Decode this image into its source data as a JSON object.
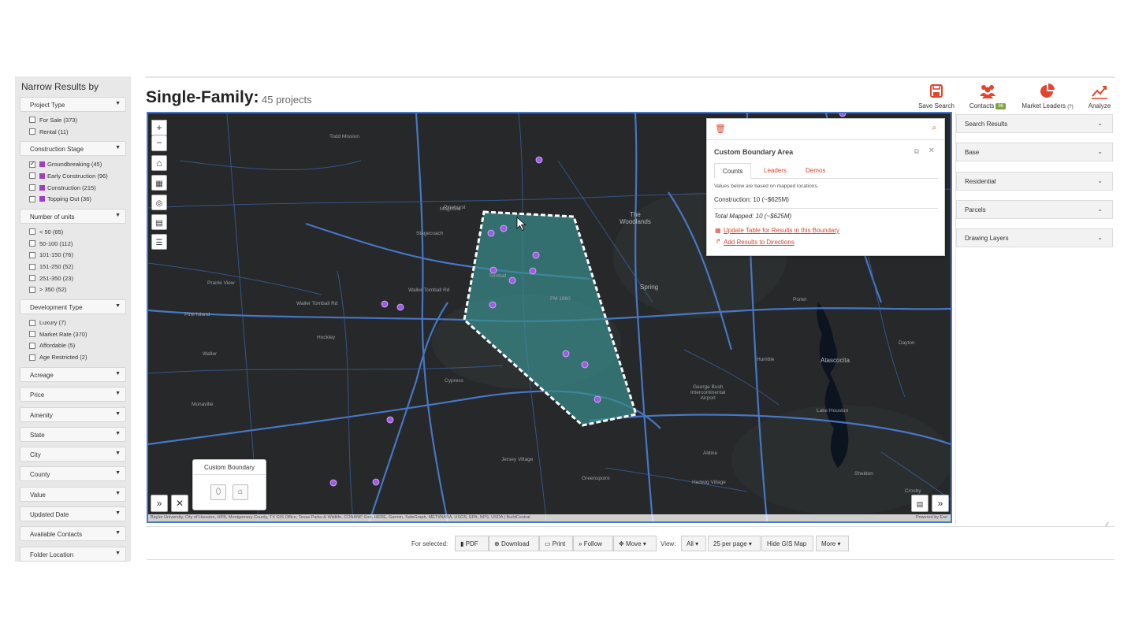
{
  "sidebar": {
    "title": "Narrow Results by",
    "groups": [
      {
        "label": "Project Type",
        "options": [
          {
            "label": "For Sale (373)",
            "checked": false
          },
          {
            "label": "Rental (11)",
            "checked": false
          }
        ]
      },
      {
        "label": "Construction Stage",
        "options": [
          {
            "label": "Groundbreaking (45)",
            "checked": true
          },
          {
            "label": "Early Construction (96)",
            "checked": false
          },
          {
            "label": "Construction (215)",
            "checked": false
          },
          {
            "label": "Topping Out (36)",
            "checked": false
          }
        ]
      },
      {
        "label": "Number of units",
        "options": [
          {
            "label": "< 50 (65)",
            "checked": false
          },
          {
            "label": "50-100 (112)",
            "checked": false
          },
          {
            "label": "101-150 (76)",
            "checked": false
          },
          {
            "label": "151-250 (52)",
            "checked": false
          },
          {
            "label": "251-350 (23)",
            "checked": false
          },
          {
            "label": "> 350 (52)",
            "checked": false
          }
        ]
      },
      {
        "label": "Development Type",
        "options": [
          {
            "label": "Luxury (7)",
            "checked": false
          },
          {
            "label": "Market Rate (370)",
            "checked": false
          },
          {
            "label": "Affordable (5)",
            "checked": false
          },
          {
            "label": "Age Restricted (2)",
            "checked": false
          }
        ]
      }
    ],
    "closed_filters": [
      "Acreage",
      "Price",
      "Amenity",
      "State",
      "City",
      "County",
      "Value",
      "Updated Date",
      "Available Contacts",
      "Folder Location"
    ],
    "stage_color": "#9b3fc8"
  },
  "header": {
    "title": "Single-Family:",
    "count": "45 projects",
    "actions": [
      {
        "label": "Save Search",
        "icon": "save-icon"
      },
      {
        "label": "Contacts",
        "badge": "86",
        "icon": "contacts-icon"
      },
      {
        "label": "Market Leaders",
        "suffix": "(?)",
        "icon": "pie-chart-icon"
      },
      {
        "label": "Analyze",
        "icon": "line-chart-icon"
      }
    ],
    "accent": "#e2452d"
  },
  "map": {
    "labels": {
      "todd_mission": "Todd Mission",
      "magnolia": "Magnolia",
      "the_woodlands": "The\nWoodlands",
      "prairie_view": "Prairie View",
      "pine_island": "Pine Island",
      "hockley": "Hockley",
      "waller": "Waller",
      "spring": "Spring",
      "humble": "Humble",
      "atascocita": "Atascocita",
      "cypress": "Cypress",
      "airport": "George Bush\nIntercontinental\nAirport",
      "monaville": "Monaville",
      "jersey_village": "Jersey Village",
      "waller_tomball_rd": "Waller Tomball Rd",
      "stagecoach": "Stagecoach",
      "tomball": "Tomball",
      "pinehurst": "Pinehurst",
      "aldine": "Aldine",
      "sheldon": "Sheldon",
      "lake_houston": "Lake Houston",
      "crosby": "Crosby",
      "greenspoint": "Greenspoint",
      "hedwig": "Hedwig Village",
      "fm1960": "FM 1960",
      "porter": "Porter",
      "dayton": "Dayton"
    },
    "attribution": "Baylor University, City of Houston, HPB, Montgomery County, TX GIS Office, Texas Parks & Wildlife, CONANP, Esri, HERE, Garmin, SafeGraph, METI/NASA, USGS, EPA, NPS, USDA | BuildCentral",
    "powered_by": "Powered by Esri",
    "map_bg": "#262829",
    "boundary_fill": "#3a8a8c",
    "marker_color": "#a15ae6"
  },
  "custom_boundary": {
    "title": "Custom Boundary"
  },
  "info_panel": {
    "title": "Custom Boundary Area",
    "tabs": [
      "Counts",
      "Leaders",
      "Demos"
    ],
    "note": "Values below are based on mapped locations.",
    "construction": "Construction: 10 (~$625M)",
    "total": "Total Mapped: 10 (~$625M)",
    "link_update": "Update Table for Results in this Boundary",
    "link_directions": "Add Results to Directions"
  },
  "layers": [
    "Search Results",
    "Base",
    "Residential",
    "Parcels",
    "Drawing Layers"
  ],
  "bottom": {
    "for_selected": "For selected:",
    "actions": [
      "PDF",
      "Download",
      "Print",
      "Follow",
      "Move ▾"
    ],
    "view_label": "View:",
    "view_all": "All ▾",
    "per_page": "25 per page ▾",
    "hide_map": "Hide GIS Map",
    "more": "More ▾"
  }
}
